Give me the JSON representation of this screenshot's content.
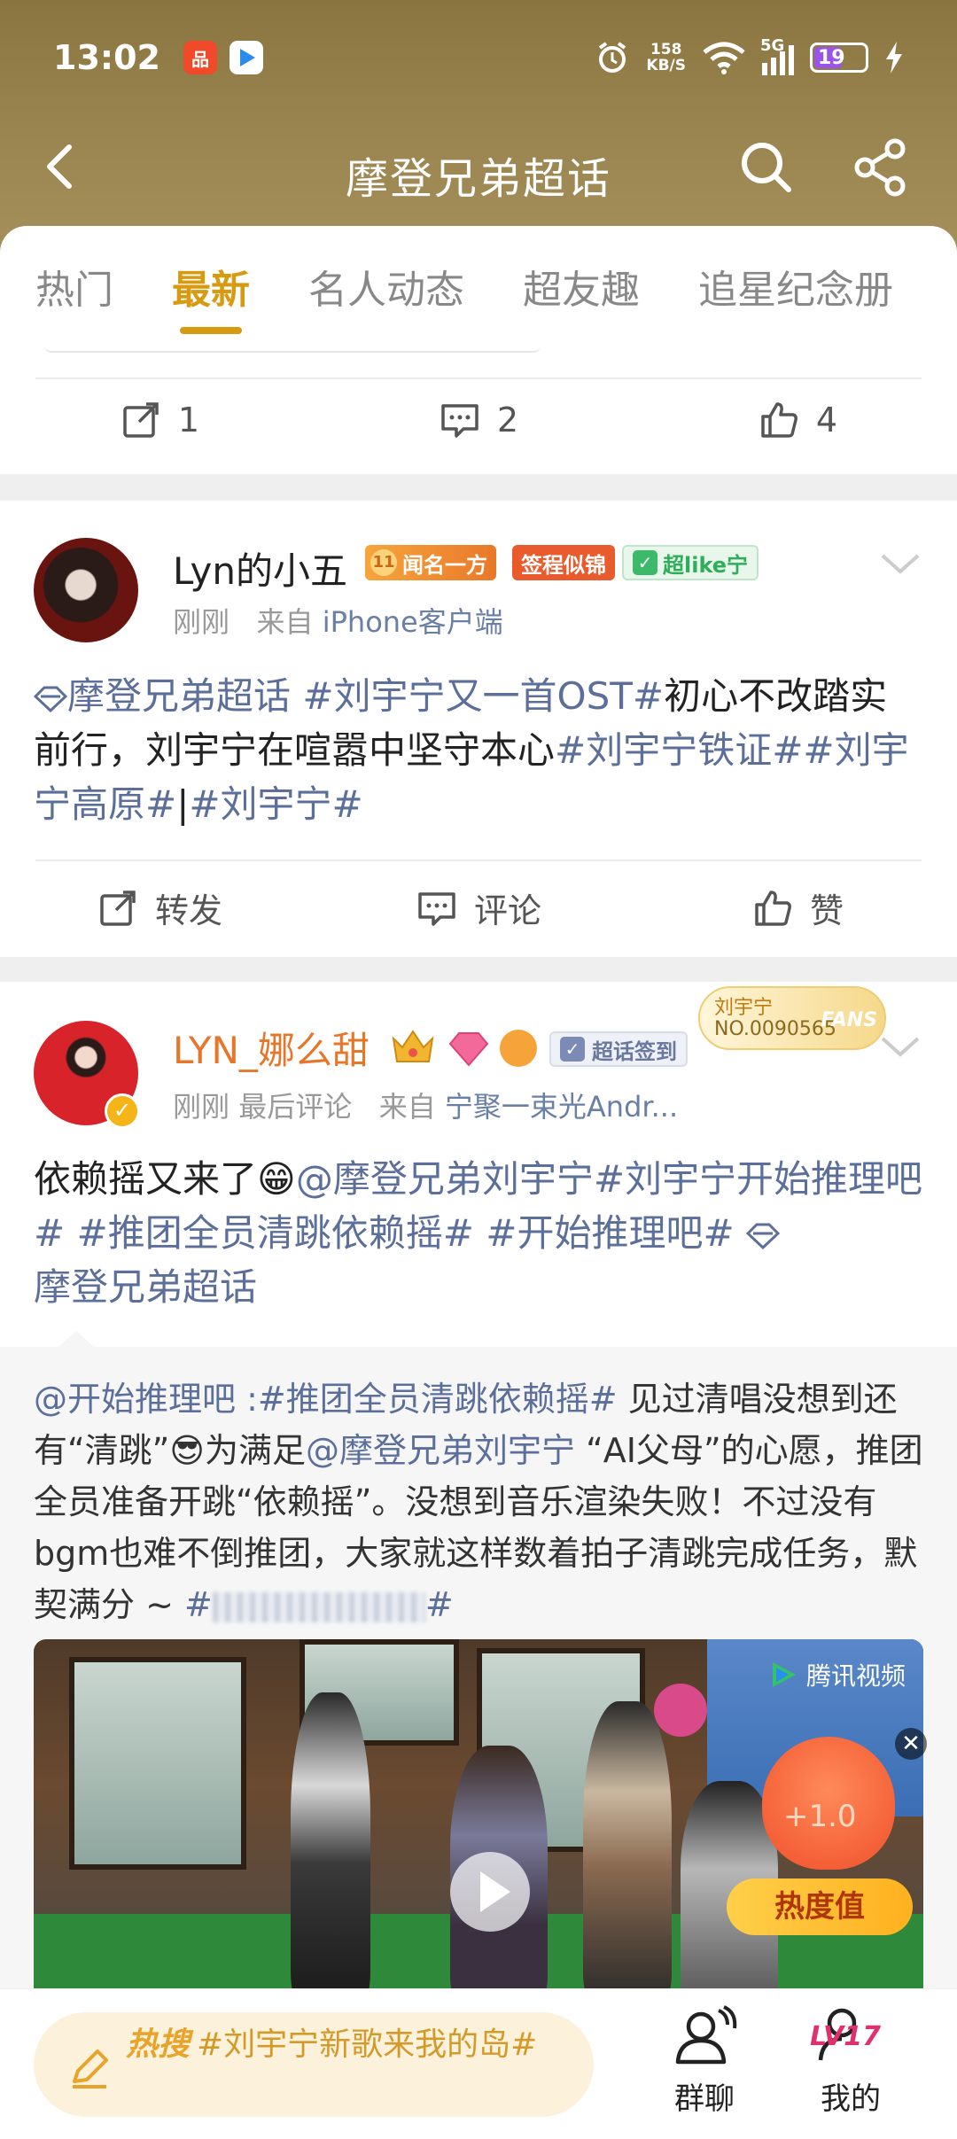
{
  "status_bar": {
    "time": "13:02",
    "speed_value": "158",
    "speed_unit": "KB/S",
    "network": "5G",
    "battery": "19"
  },
  "nav": {
    "title": "摩登兄弟超话"
  },
  "tabs": [
    "热门",
    "最新",
    "名人动态",
    "超友趣",
    "追星纪念册"
  ],
  "active_tab": "最新",
  "prev_post": {
    "repost_count": "1",
    "comment_count": "2",
    "like_count": "4"
  },
  "post1": {
    "username": "Lyn的小五",
    "badges": [
      "闻名一方",
      "签程似锦",
      "超like宁"
    ],
    "level_num": "11",
    "time": "刚刚",
    "source_prefix": "来自",
    "source": "iPhone客户端",
    "text": {
      "t1": "摩登兄弟超话",
      "t2": " #刘宇宁又一首OST#",
      "t3": "初心不改踏实前行，刘宇宁在喧嚣中坚守本心",
      "t4": "#刘宇宁铁证##刘宇宁高原#",
      "t5": "|",
      "t6": "#刘宇宁#"
    },
    "actions": {
      "repost": "转发",
      "comment": "评论",
      "like": "赞"
    }
  },
  "post2": {
    "username": "LYN_娜么甜",
    "badge": "超话签到",
    "fan_card_name": "刘宇宁",
    "fan_card_no": "NO.0090565",
    "fan_card_label": "FANS",
    "time": "刚刚",
    "last_comment": "最后评论",
    "source_prefix": "来自",
    "source": "宁聚一束光Andr...",
    "text": {
      "t1": "依赖摇又来了",
      "emoji": "😁",
      "t2": "@摩登兄弟刘宇宁#刘宇宁开始推理吧 # #推团全员清跳依赖摇# #开始推理吧#",
      "t3": "摩登兄弟超话"
    },
    "repost": {
      "r1": "@开始推理吧 :#推团全员清跳依赖摇#",
      "r2": " 见过清唱没想到还有“清跳”",
      "emoji": "😎",
      "r3": "为满足",
      "r4": "@摩登兄弟刘宇宁",
      "r5": " “AI父母”的心愿，推团全员准备开跳“依赖摇”。没想到音乐渲染失败！不过没有bgm也难不倒推团，大家就这样数着拍子清跳完成任务，默契满分 ~ ",
      "r6": "#",
      "r7": "#"
    },
    "video": {
      "logo": "腾讯视频",
      "hot_value": "+1.0",
      "hot_label": "热度值",
      "close": "✕"
    }
  },
  "bottom": {
    "hot_label": "热搜",
    "hot_text": "#刘宇宁新歌来我的岛#",
    "group_chat": "群聊",
    "me": "我的",
    "level": "LV17"
  }
}
